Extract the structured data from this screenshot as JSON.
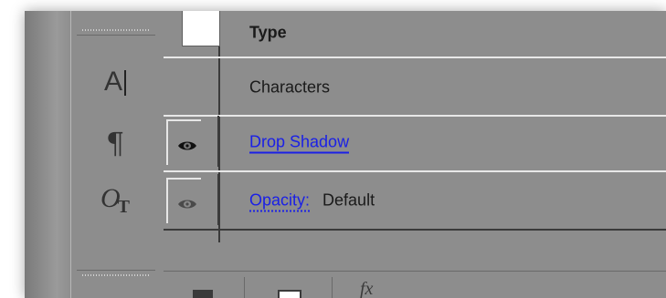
{
  "toolbar": {
    "tools": [
      {
        "glyph": "A"
      },
      {
        "glyph": "¶"
      },
      {
        "glyph": "O",
        "sub": "T"
      }
    ]
  },
  "panel": {
    "rows": [
      {
        "label": "Type"
      },
      {
        "label": "Characters"
      },
      {
        "label": "Drop Shadow",
        "visible": true
      },
      {
        "label": "Opacity:",
        "value": "Default",
        "visible": false
      }
    ]
  },
  "bottombar": {
    "fx_label": "fx"
  }
}
